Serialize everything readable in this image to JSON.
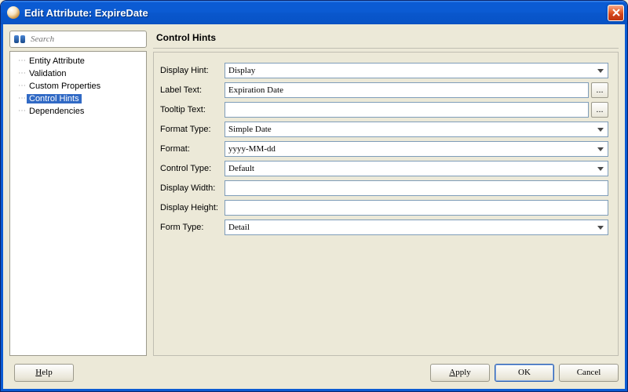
{
  "window": {
    "title": "Edit Attribute: ExpireDate"
  },
  "sidebar": {
    "search_placeholder": "Search",
    "items": [
      {
        "label": "Entity Attribute",
        "selected": false
      },
      {
        "label": "Validation",
        "selected": false
      },
      {
        "label": "Custom Properties",
        "selected": false
      },
      {
        "label": "Control Hints",
        "selected": true
      },
      {
        "label": "Dependencies",
        "selected": false
      }
    ]
  },
  "content": {
    "heading": "Control Hints",
    "fields": {
      "display_hint": {
        "label": "Display Hint:",
        "value": "Display",
        "type": "combo"
      },
      "label_text": {
        "label": "Label Text:",
        "value": "Expiration Date",
        "type": "text_dots"
      },
      "tooltip_text": {
        "label": "Tooltip Text:",
        "value": "",
        "type": "text_dots"
      },
      "format_type": {
        "label": "Format Type:",
        "value": "Simple Date",
        "type": "combo"
      },
      "format": {
        "label": "Format:",
        "value": "yyyy-MM-dd",
        "type": "combo_editable"
      },
      "control_type": {
        "label": "Control Type:",
        "value": "Default",
        "type": "combo"
      },
      "display_width": {
        "label": "Display Width:",
        "value": "",
        "type": "text"
      },
      "display_height": {
        "label": "Display Height:",
        "value": "",
        "type": "text"
      },
      "form_type": {
        "label": "Form Type:",
        "value": "Detail",
        "type": "combo"
      }
    }
  },
  "buttons": {
    "help": "Help",
    "apply": "Apply",
    "ok": "OK",
    "cancel": "Cancel"
  },
  "icons": {
    "ellipsis": "..."
  }
}
